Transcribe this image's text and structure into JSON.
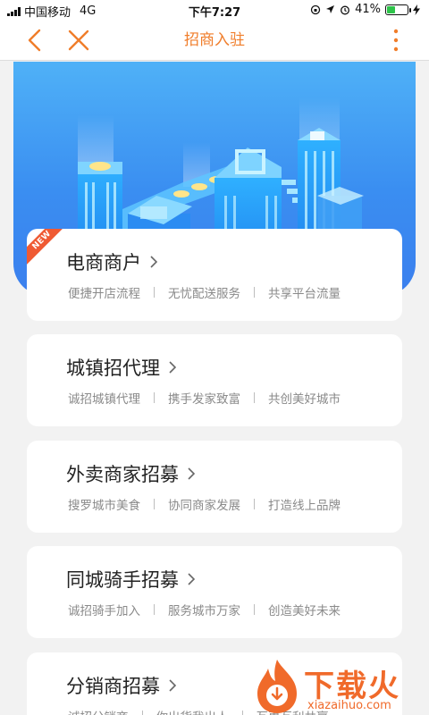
{
  "status_bar": {
    "carrier": "中国移动",
    "network": "4G",
    "time": "下午7:27",
    "battery": "41%",
    "battery_level": 0.41
  },
  "nav": {
    "title": "招商入驻"
  },
  "cards": [
    {
      "title": "电商商户",
      "badge": "NEW",
      "tags": [
        "便捷开店流程",
        "无忧配送服务",
        "共享平台流量"
      ]
    },
    {
      "title": "城镇招代理",
      "tags": [
        "诚招城镇代理",
        "携手发家致富",
        "共创美好城市"
      ]
    },
    {
      "title": "外卖商家招募",
      "tags": [
        "搜罗城市美食",
        "协同商家发展",
        "打造线上品牌"
      ]
    },
    {
      "title": "同城骑手招募",
      "tags": [
        "诚招骑手加入",
        "服务城市万家",
        "创造美好未来"
      ]
    },
    {
      "title": "分销商招募",
      "tags": [
        "诚招分销商",
        "你出货我出人",
        "互惠互利共赢"
      ]
    }
  ],
  "watermark": {
    "text": "下载火",
    "url": "xiazaihuo.com"
  },
  "colors": {
    "accent": "#f07d2a",
    "banner_top": "#4fb1f7",
    "banner_bottom": "#3b7fee",
    "badge": "#ef5a33"
  }
}
